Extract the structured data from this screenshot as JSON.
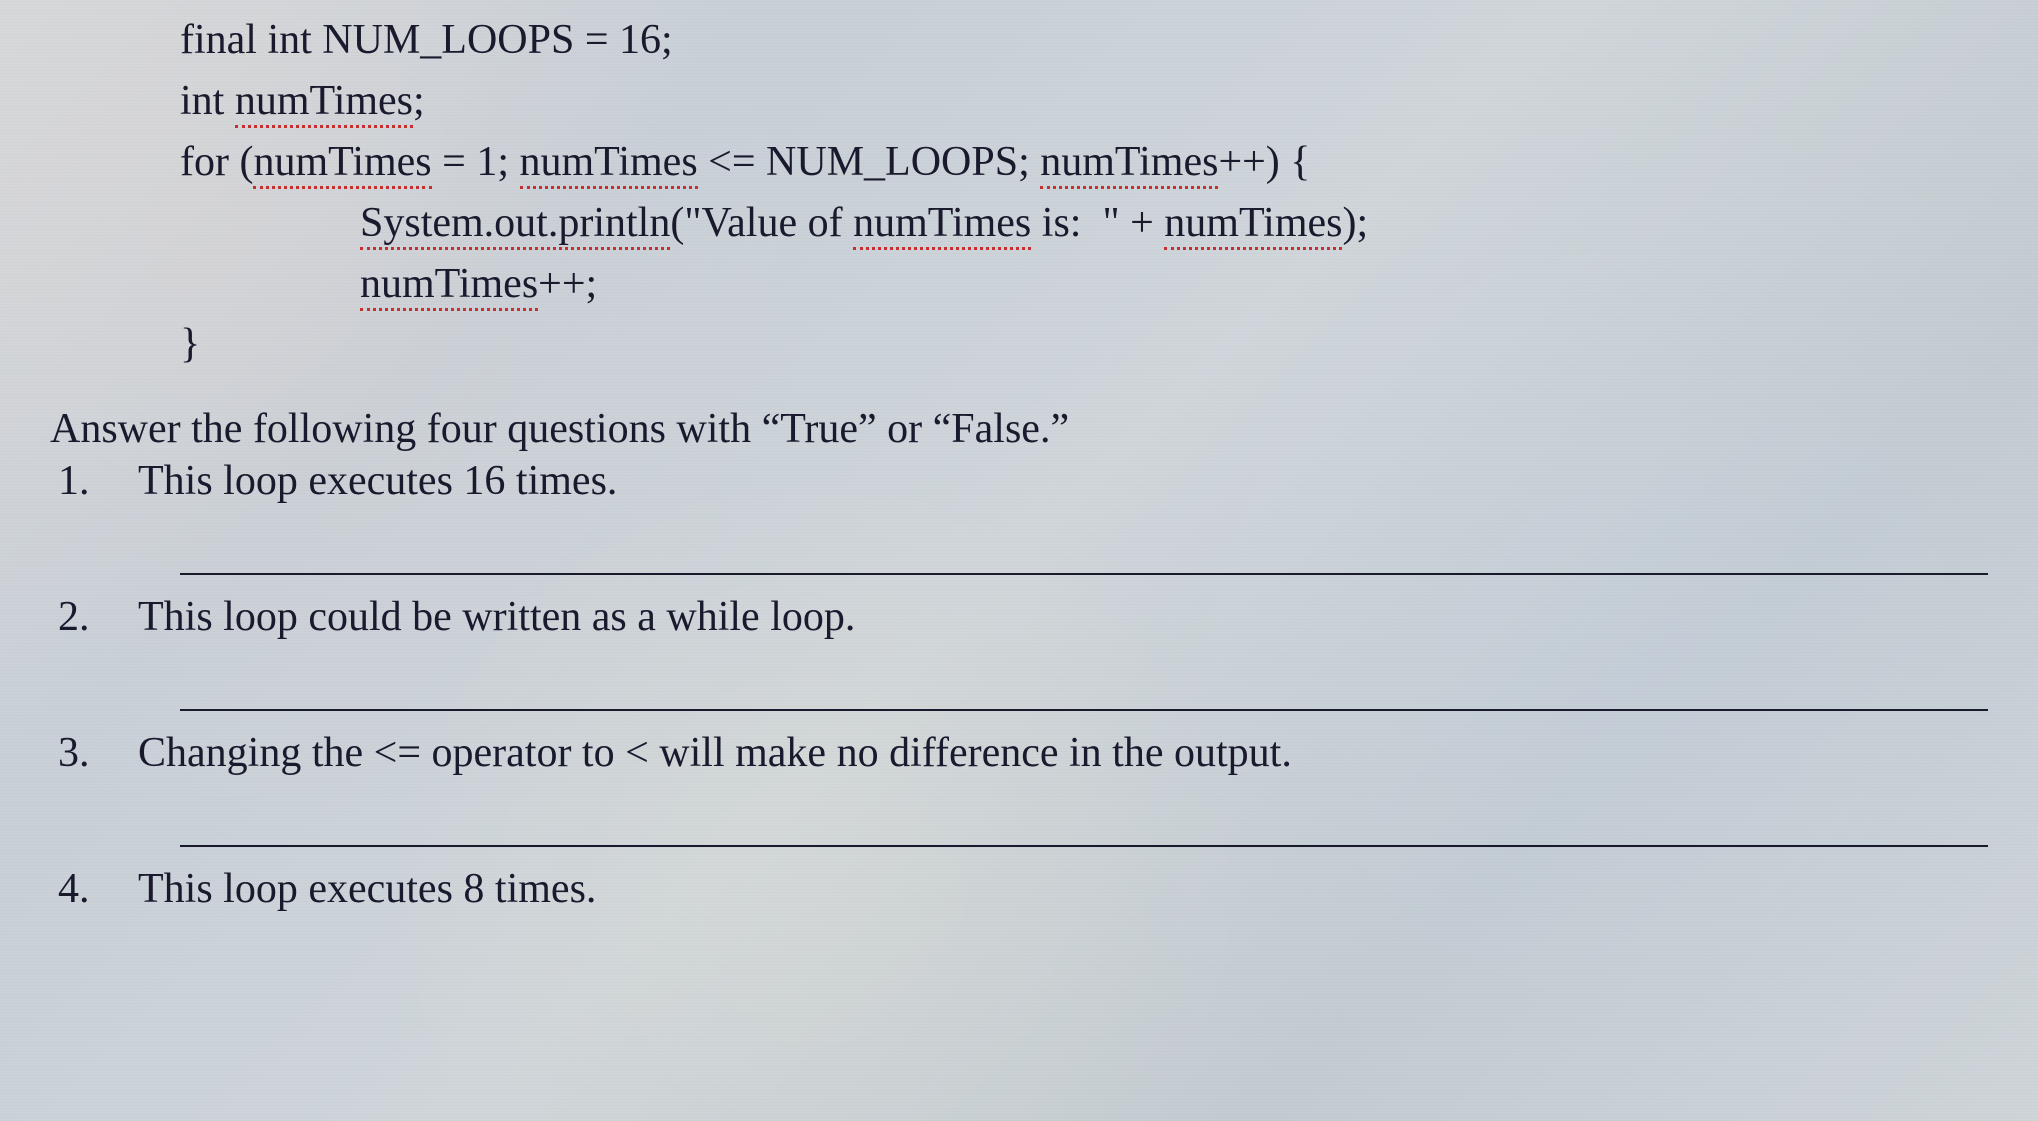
{
  "code": {
    "line1_a": "final int NUM_LOOPS = 16;",
    "line2_a": "int",
    "line2_b": "numTimes",
    "line2_c": ";",
    "line3_a": "for (",
    "line3_b": "numTimes",
    "line3_c": " = 1; ",
    "line3_d": "numTimes",
    "line3_e": " <= NUM_LOOPS; ",
    "line3_f": "numTimes",
    "line3_g": "++) {",
    "line4_a": "System.out.println",
    "line4_b": "(\"Value of ",
    "line4_c": "numTimes",
    "line4_d": " is:  \" + ",
    "line4_e": "numTimes",
    "line4_f": ");",
    "line5_a": "numTimes",
    "line5_b": "++;",
    "line6_a": "}"
  },
  "intro": "Answer the following four questions with “True” or “False.”",
  "questions": [
    {
      "num": "1.",
      "text": "This loop executes 16 times."
    },
    {
      "num": "2.",
      "text": "This loop could be written as a while loop."
    },
    {
      "num": "3.",
      "text": "Changing the <= operator to < will make no difference in the output."
    },
    {
      "num": "4.",
      "text": "This loop executes 8 times."
    }
  ]
}
